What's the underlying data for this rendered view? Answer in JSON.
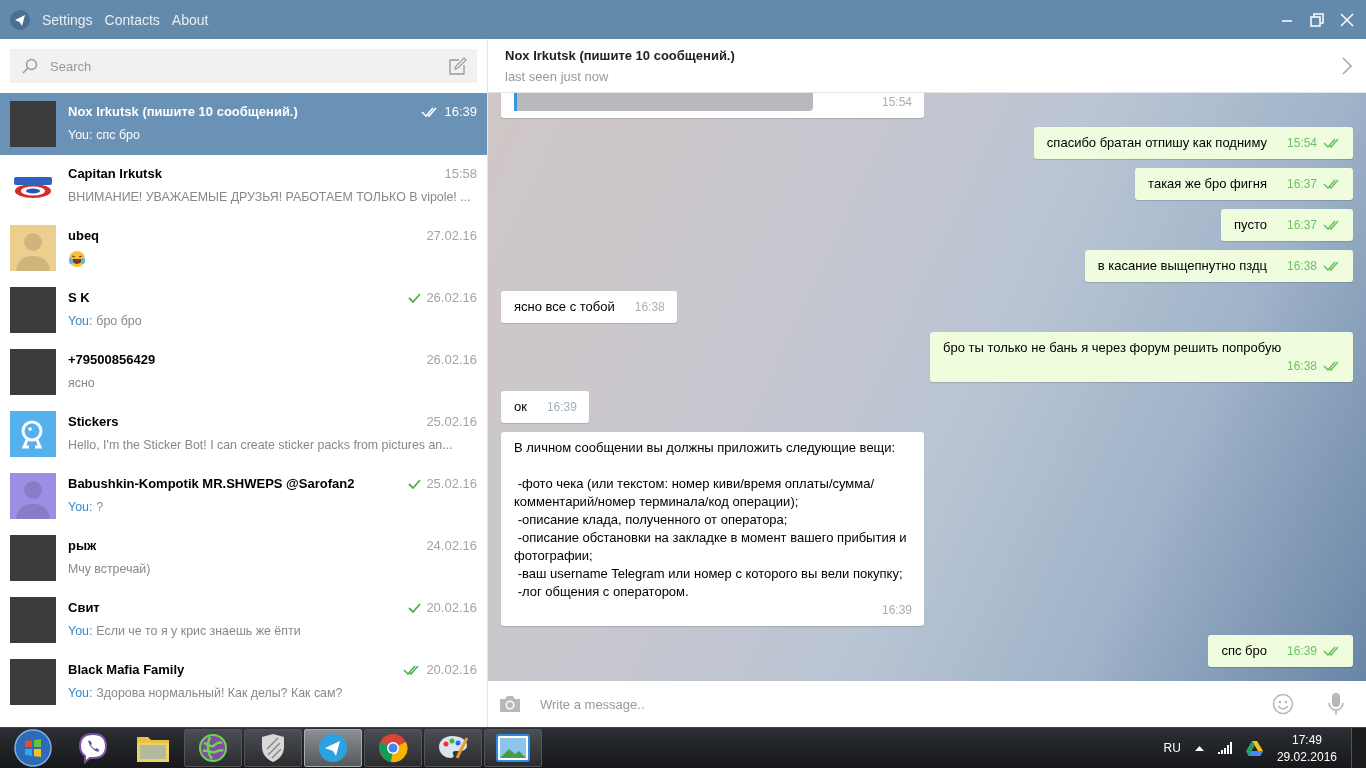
{
  "window": {
    "menu": [
      "Settings",
      "Contacts",
      "About"
    ]
  },
  "sidebar": {
    "search": {
      "placeholder": "Search"
    },
    "chats": [
      {
        "name": "Nox Irkutsk (пишите 10 сообщений.)",
        "sender": "You:",
        "preview": "спс бро",
        "time": "16:39",
        "status": {
          "read": true
        },
        "selected": true,
        "avatar": {
          "kind": "photo"
        }
      },
      {
        "name": "Capitan Irkutsk",
        "preview": "ВНИМАНИЕ! УВАЖАЕМЫЕ ДРУЗЬЯ! РАБОТАЕМ ТОЛЬКО В vipole! ...",
        "time": "15:58",
        "selected": false,
        "avatar": {
          "kind": "emblem"
        }
      },
      {
        "name": "ubeq",
        "emoji": true,
        "time": "27.02.16",
        "selected": false,
        "avatar": {
          "kind": "silhouette",
          "color": "#eccf8c"
        }
      },
      {
        "name": "S K",
        "sender": "You:",
        "preview": "бро бро",
        "time": "26.02.16",
        "status": {
          "read": false
        },
        "selected": false,
        "avatar": {
          "kind": "photo"
        }
      },
      {
        "name": "+79500856429",
        "preview": "ясно",
        "time": "26.02.16",
        "selected": false,
        "avatar": {
          "kind": "photo"
        }
      },
      {
        "name": "Stickers",
        "preview": "Hello, I'm the Sticker Bot! I can create sticker packs from pictures an...",
        "time": "25.02.16",
        "selected": false,
        "avatar": {
          "kind": "bot",
          "color": "#55b0ee"
        }
      },
      {
        "name": "Babushkin-Kompotik MR.SHWEPS @Sarofan2",
        "sender": "You:",
        "preview": "?",
        "time": "25.02.16",
        "status": {
          "read": false
        },
        "selected": false,
        "avatar": {
          "kind": "silhouette",
          "color": "#9a8fe3"
        }
      },
      {
        "name": "рыж",
        "preview": "Мчу встречай)",
        "time": "24.02.16",
        "selected": false,
        "avatar": {
          "kind": "photo"
        }
      },
      {
        "name": "Свит",
        "sender": "You:",
        "preview": "Если че то я у крис знаешь же ёпти",
        "time": "20.02.16",
        "status": {
          "read": false
        },
        "selected": false,
        "avatar": {
          "kind": "photo"
        }
      },
      {
        "name": "Black Mafia Family",
        "sender": "You:",
        "preview": "Здорова нормальный! Как делы? Как сам?",
        "time": "20.02.16",
        "status": {
          "read": true
        },
        "selected": false,
        "avatar": {
          "kind": "photo"
        }
      }
    ]
  },
  "chat": {
    "title": "Nox Irkutsk (пишите 10 сообщений.)",
    "status": "last seen just now",
    "messages": [
      {
        "kind": "photo",
        "outgoing": false,
        "time": "15:54"
      },
      {
        "kind": "text",
        "outgoing": true,
        "text": "спасибо братан отпишу как подниму",
        "time": "15:54",
        "read": true
      },
      {
        "kind": "text",
        "outgoing": true,
        "text": "такая же бро фигня",
        "time": "16:37",
        "read": true
      },
      {
        "kind": "text",
        "outgoing": true,
        "text": "пусто",
        "time": "16:37",
        "read": true
      },
      {
        "kind": "text",
        "outgoing": true,
        "text": "в касание выщепнутно пздц",
        "time": "16:38",
        "read": true
      },
      {
        "kind": "text",
        "outgoing": false,
        "text": "ясно все с тобой",
        "time": "16:38"
      },
      {
        "kind": "text",
        "outgoing": true,
        "text": "бро ты только не бань я через форум решить попробую",
        "time": "16:38",
        "read": true
      },
      {
        "kind": "text",
        "outgoing": false,
        "text": "ок",
        "time": "16:39"
      },
      {
        "kind": "text",
        "outgoing": false,
        "text": "В личном сообщении вы должны приложить следующие вещи:\n\n -фото чека (или текстом: номер киви/время оплаты/сумма/комментарий/номер терминала/код операции);\n -описание клада, полученного от оператора;\n -описание обстановки на закладке в момент вашего прибытия и фотографии;\n -ваш username Telegram или номер с которого вы вели покупку;\n -лог общения с оператором.",
        "time": "16:39"
      },
      {
        "kind": "text",
        "outgoing": true,
        "text": "спс бро",
        "time": "16:39",
        "read": true
      }
    ],
    "composer": {
      "placeholder": "Write a message.."
    }
  },
  "taskbar": {
    "apps": [
      {
        "kind": "pinned"
      },
      {
        "kind": "pinned"
      },
      {
        "kind": "pinned"
      },
      {
        "kind": "running",
        "selected": false
      },
      {
        "kind": "running",
        "selected": false
      },
      {
        "kind": "running",
        "selected": true
      },
      {
        "kind": "running",
        "selected": false
      },
      {
        "kind": "running",
        "selected": false
      },
      {
        "kind": "running",
        "selected": false
      }
    ],
    "language": "RU",
    "time": "17:49",
    "date": "29.02.2016"
  }
}
